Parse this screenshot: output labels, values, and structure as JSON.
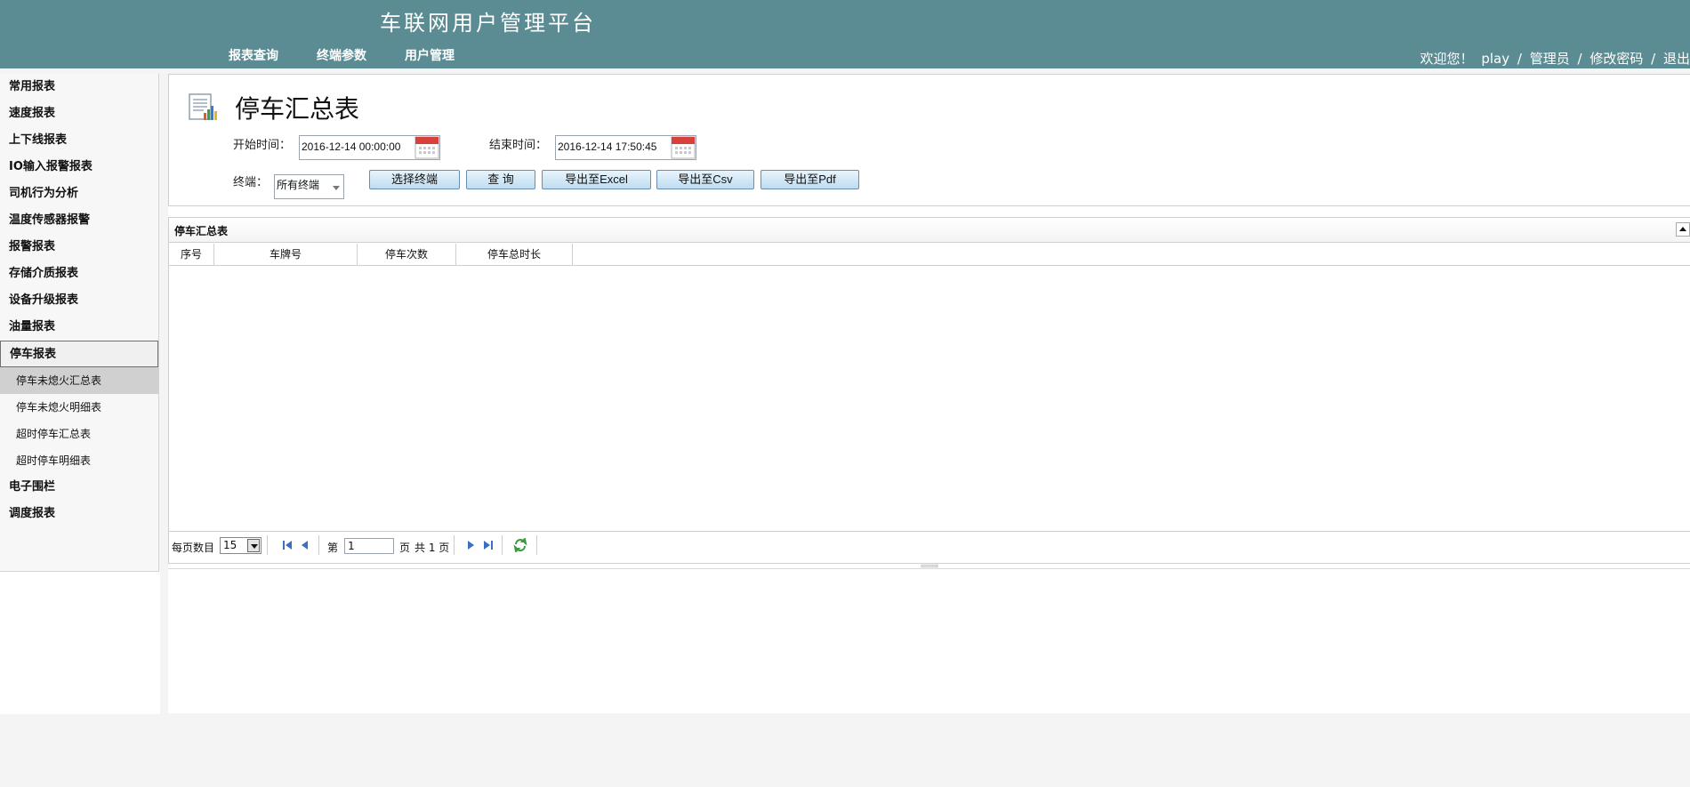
{
  "header": {
    "app_title": "车联网用户管理平台",
    "nav": [
      "报表查询",
      "终端参数",
      "用户管理"
    ],
    "welcome": "欢迎您！",
    "username": "play",
    "separator": "/",
    "role": "管理员",
    "change_password": "修改密码",
    "logout": "退出"
  },
  "sidebar": {
    "items_top": [
      "常用报表",
      "速度报表",
      "上下线报表",
      "IO输入报警报表",
      "司机行为分析",
      "温度传感器报警",
      "报警报表",
      "存储介质报表",
      "设备升级报表",
      "油量报表"
    ],
    "active_group": "停车报表",
    "sub_items": [
      "停车未熄火汇总表",
      "停车未熄火明细表",
      "超时停车汇总表",
      "超时停车明细表"
    ],
    "selected_sub_index": 0,
    "items_bottom": [
      "电子围栏",
      "调度报表"
    ]
  },
  "filter": {
    "page_title": "停车汇总表",
    "start_label": "开始时间：",
    "start_value": "2016-12-14 00:00:00",
    "end_label": "结束时间：",
    "end_value": "2016-12-14 17:50:45",
    "terminal_label": "终端：",
    "terminal_value": "所有终端",
    "buttons": {
      "select_terminal": "选择终端",
      "query": "查 询",
      "export_excel": "导出至Excel",
      "export_csv": "导出至Csv",
      "export_pdf": "导出至Pdf"
    }
  },
  "grid": {
    "title": "停车汇总表",
    "columns": [
      "序号",
      "车牌号",
      "停车次数",
      "停车总时长"
    ],
    "rows": []
  },
  "pager": {
    "per_page_label": "每页数目",
    "per_page_value": "15",
    "page_prefix": "第",
    "current_page": "1",
    "page_suffix": "页",
    "total_pages": "共 1 页"
  },
  "colors": {
    "header_bg": "#5c8c93",
    "button_top": "#e8f4fc",
    "button_bottom": "#bfdcf0",
    "selected_sub_bg": "#d0d0d0"
  }
}
